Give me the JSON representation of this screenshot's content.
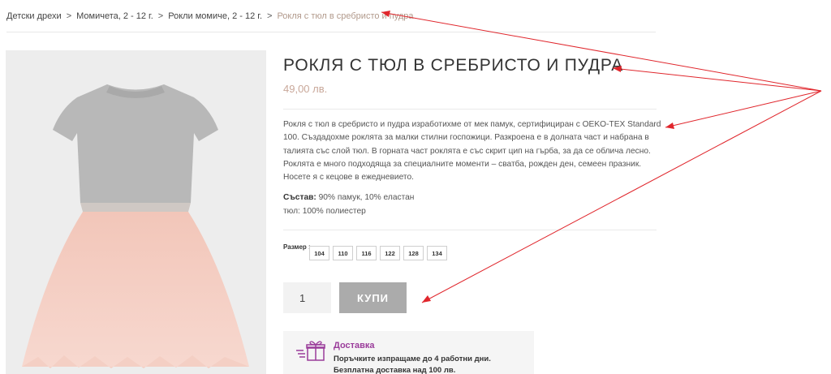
{
  "breadcrumb": {
    "items": [
      "Детски дрехи",
      "Момичета, 2 - 12 г.",
      "Рокли момиче, 2 - 12 г."
    ],
    "separator": ">",
    "current": "Рокля с тюл в сребристо и пудра"
  },
  "product": {
    "title": "РОКЛЯ С ТЮЛ В СРЕБРИСТО И ПУДРА",
    "price": "49,00 лв.",
    "description": "Рокля с тюл в сребристо и пудра изработихме от мек памук, сертифициран с OEKO-TEX Standard 100. Създадохме роклята за малки стилни госпожици. Разкроена е в долната част и набрана в талията със слой тюл. В горната част роклята е със скрит цип на гърба, за да се облича лесно. Роклята е много подходяща за специалните моменти – сватба, рожден ден, семеен празник. Носете я с кецове в ежедневието.",
    "composition_label": "Състав:",
    "composition_value": " 90% памук, 10% еластан",
    "composition_line2": "тюл: 100% полиестер"
  },
  "sizes": {
    "label": "Размер :",
    "options": [
      "104",
      "110",
      "116",
      "122",
      "128",
      "134"
    ]
  },
  "purchase": {
    "quantity": "1",
    "buy_label": "КУПИ"
  },
  "delivery": {
    "icon": "gift-delivery-icon",
    "title": "Доставка",
    "line1": "Поръчките изпращаме до 4 работни дни.",
    "line2": "Безплатна доставка над 100 лв."
  },
  "colors": {
    "price": "#c9a89a",
    "breadcrumb_current": "#b29a8c",
    "buy_button": "#ababab",
    "delivery_title": "#9a3c9a",
    "annotation_arrow": "#e0262c"
  }
}
